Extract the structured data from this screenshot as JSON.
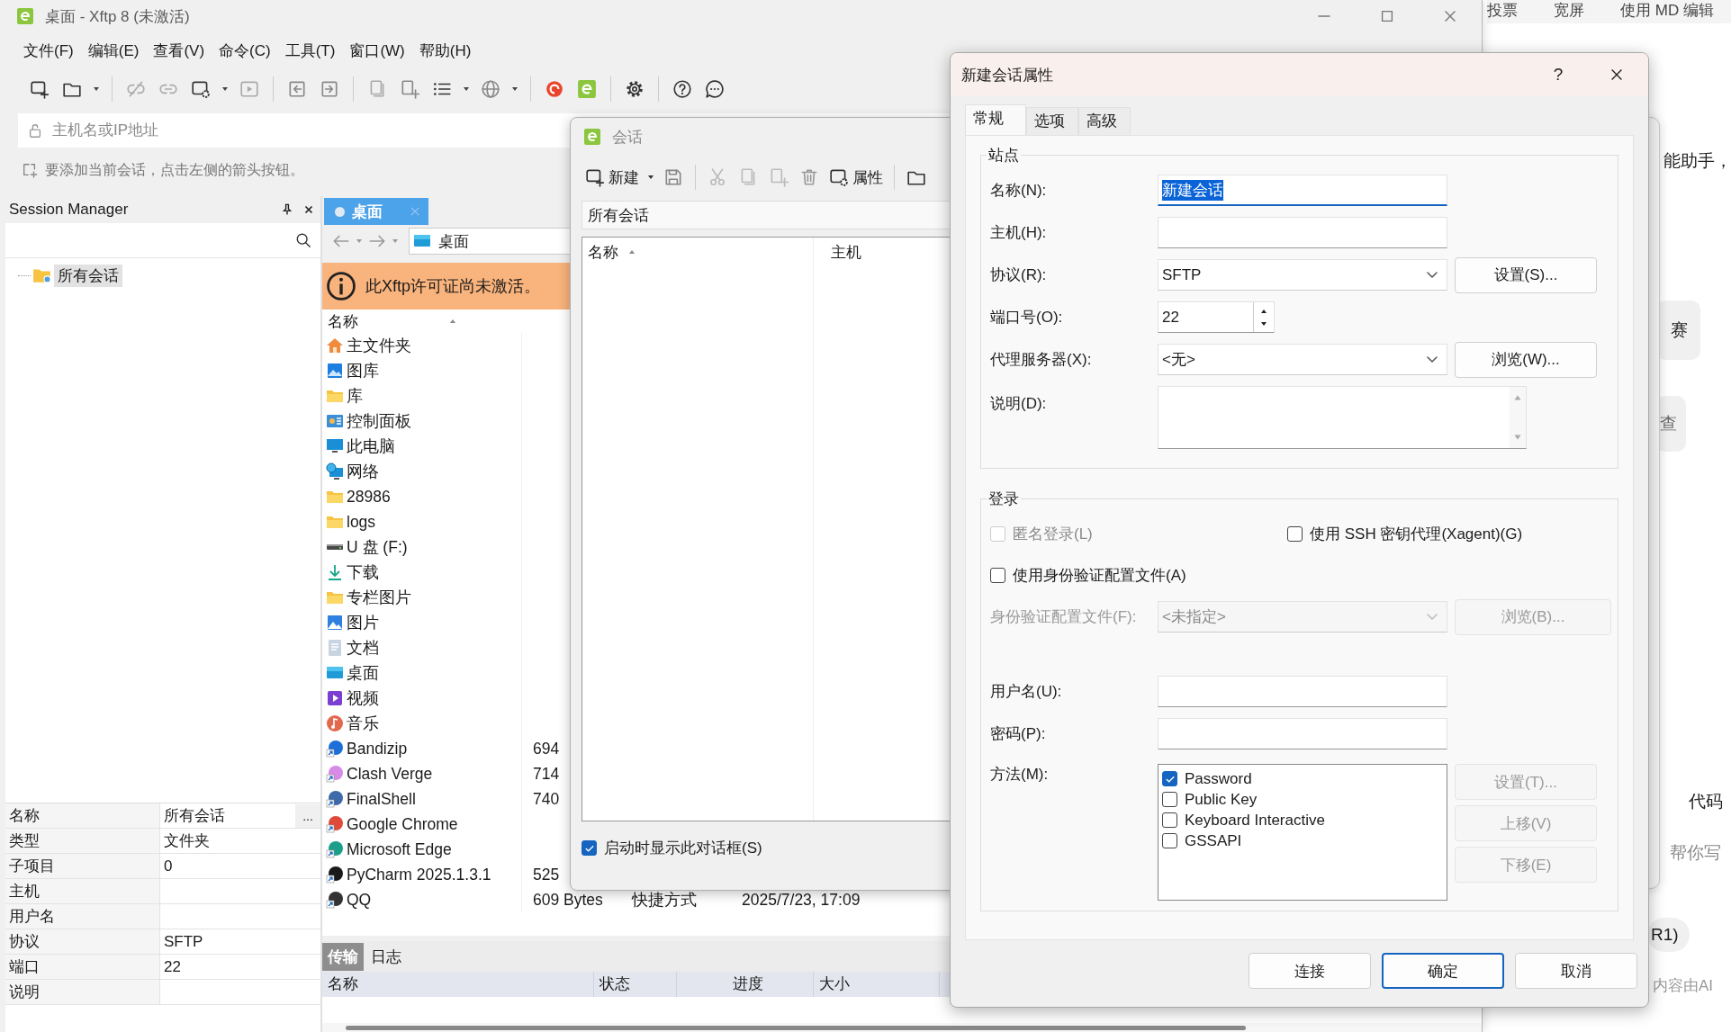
{
  "main_window": {
    "title": "桌面 - Xftp 8 (未激活)",
    "menu": [
      "文件(F)",
      "编辑(E)",
      "查看(V)",
      "命令(C)",
      "工具(T)",
      "窗口(W)",
      "帮助(H)"
    ],
    "address_placeholder": "主机名或IP地址",
    "hint": "要添加当前会话，点击左侧的箭头按钮。"
  },
  "session_manager": {
    "title": "Session Manager",
    "tree": [
      {
        "label": "所有会话",
        "selected": true
      }
    ],
    "properties": [
      {
        "name": "名称",
        "value": "所有会话"
      },
      {
        "name": "类型",
        "value": "文件夹"
      },
      {
        "name": "子项目",
        "value": "0"
      },
      {
        "name": "主机"
      },
      {
        "name": "用户名"
      },
      {
        "name": "协议",
        "value": "SFTP"
      },
      {
        "name": "端口",
        "value": "22"
      },
      {
        "name": "说明"
      }
    ],
    "more_button": "..."
  },
  "file_pane": {
    "tab": {
      "label": "桌面"
    },
    "path": "桌面",
    "banner": "此Xftp许可证尚未激活。",
    "column": "名称",
    "rows": [
      {
        "name": "主文件夹"
      },
      {
        "name": "图库"
      },
      {
        "name": "库"
      },
      {
        "name": "控制面板"
      },
      {
        "name": "此电脑"
      },
      {
        "name": "网络"
      },
      {
        "name": "28986"
      },
      {
        "name": "logs"
      },
      {
        "name": "U 盘 (F:)"
      },
      {
        "name": "下载"
      },
      {
        "name": "专栏图片"
      },
      {
        "name": "图片"
      },
      {
        "name": "文档"
      },
      {
        "name": "桌面"
      },
      {
        "name": "视频"
      },
      {
        "name": "音乐"
      },
      {
        "name": "Bandizip",
        "size": "694"
      },
      {
        "name": "Clash Verge",
        "size": "714"
      },
      {
        "name": "FinalShell",
        "size": "740"
      },
      {
        "name": "Google Chrome"
      },
      {
        "name": "Microsoft Edge"
      },
      {
        "name": "PyCharm 2025.1.3.1",
        "size": "525"
      },
      {
        "name": "QQ",
        "size": "609 Bytes",
        "type": "快捷方式",
        "modified": "2025/7/23, 17:09"
      }
    ]
  },
  "transfer_pane": {
    "tabs": [
      {
        "label": "传输",
        "selected": true
      },
      {
        "label": "日志",
        "selected": false
      }
    ],
    "columns": [
      "名称",
      "状态",
      "进度",
      "大小"
    ]
  },
  "session_dialog": {
    "title": "会话",
    "new_button": "新建",
    "properties_button": "属性",
    "path": "所有会话",
    "columns": [
      "名称",
      "主机"
    ],
    "show_on_startup": {
      "label": "启动时显示此对话框(S)",
      "checked": true
    }
  },
  "properties_dialog": {
    "title": "新建会话属性",
    "help": "?",
    "tabs": [
      {
        "label": "常规",
        "selected": true
      },
      {
        "label": "选项",
        "selected": false
      },
      {
        "label": "高级",
        "selected": false
      }
    ],
    "site": {
      "title": "站点",
      "fields": [
        {
          "kind": "text",
          "label": "名称(N):",
          "value": "新建会话",
          "focused": true
        },
        {
          "kind": "text",
          "label": "主机(H):",
          "focused": false
        },
        {
          "kind": "select",
          "label": "协议(R):",
          "value": "SFTP",
          "button": "设置(S)..."
        },
        {
          "kind": "spin",
          "label": "端口号(O):",
          "value": "22"
        },
        {
          "kind": "select",
          "label": "代理服务器(X):",
          "value": "<无>",
          "button": "浏览(W)..."
        },
        {
          "kind": "textarea",
          "label": "说明(D):"
        }
      ]
    },
    "login": {
      "title": "登录",
      "anonymous": {
        "label": "匿名登录(L)",
        "checked": false,
        "disabled": true
      },
      "xagent": {
        "label": "使用 SSH 密钥代理(Xagent)(G)",
        "checked": false,
        "disabled": false
      },
      "use_profile": {
        "label": "使用身份验证配置文件(A)",
        "checked": false,
        "disabled": false
      },
      "profile": {
        "label": "身份验证配置文件(F):",
        "value": "<未指定>",
        "button": "浏览(B)...",
        "disabled": true
      },
      "username": {
        "label": "用户名(U):"
      },
      "password": {
        "label": "密码(P):"
      },
      "method": {
        "label": "方法(M):",
        "options": [
          {
            "label": "Password",
            "checked": true
          },
          {
            "label": "Public Key",
            "checked": false
          },
          {
            "label": "Keyboard Interactive",
            "checked": false
          },
          {
            "label": "GSSAPI",
            "checked": false
          }
        ],
        "buttons": [
          {
            "label": "设置(T)...",
            "disabled": true
          },
          {
            "label": "上移(V)",
            "disabled": true
          },
          {
            "label": "下移(E)",
            "disabled": true
          }
        ]
      }
    },
    "buttons": [
      {
        "label": "连接",
        "default": false
      },
      {
        "label": "确定",
        "default": true
      },
      {
        "label": "取消",
        "default": false
      }
    ]
  },
  "background_page": {
    "top_links": [
      "投票",
      "宽屏",
      "使用 MD 编辑"
    ],
    "texts": [
      "能助手，",
      "代码",
      "帮你写",
      "内容由AI"
    ],
    "chips": [
      "赛",
      "查",
      "R1)"
    ]
  }
}
